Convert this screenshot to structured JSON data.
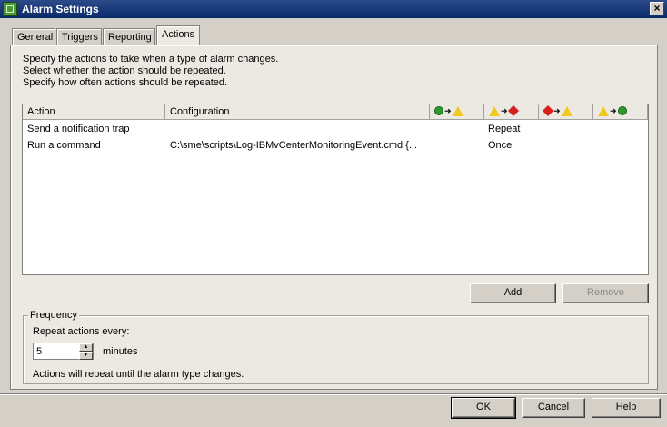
{
  "window": {
    "title": "Alarm Settings",
    "close_glyph": "×"
  },
  "tabs": [
    {
      "label": "General"
    },
    {
      "label": "Triggers"
    },
    {
      "label": "Reporting"
    },
    {
      "label": "Actions",
      "active": true
    }
  ],
  "instructions": [
    "Specify the actions to take when a type of alarm changes.",
    "Select whether the action should be repeated.",
    "Specify how often actions should be repeated."
  ],
  "table": {
    "columns": {
      "action": "Action",
      "configuration": "Configuration",
      "transition_icons": [
        {
          "from": "ok-icon",
          "to": "warning-icon"
        },
        {
          "from": "warning-icon",
          "to": "critical-icon"
        },
        {
          "from": "critical-icon",
          "to": "warning-icon"
        },
        {
          "from": "warning-icon",
          "to": "ok-icon"
        }
      ],
      "arrow_glyph": "➜"
    },
    "rows": [
      {
        "action": "Send a notification trap",
        "configuration": "",
        "warn_to_crit": "Repeat"
      },
      {
        "action": "Run a command",
        "configuration": "C:\\sme\\scripts\\Log-IBMvCenterMonitoringEvent.cmd {...",
        "warn_to_crit": "Once"
      }
    ]
  },
  "buttons": {
    "add": "Add",
    "remove": "Remove",
    "ok": "OK",
    "cancel": "Cancel",
    "help": "Help"
  },
  "frequency": {
    "legend": "Frequency",
    "repeat_label": "Repeat actions every:",
    "value": "5",
    "unit": "minutes",
    "note": "Actions will repeat until the alarm type changes.",
    "up_glyph": "▲",
    "down_glyph": "▼"
  },
  "colors": {
    "titlebar": "#0b2a6a",
    "ok": "#2e9a2e",
    "warning": "#f2c81e",
    "critical": "#d62020"
  }
}
